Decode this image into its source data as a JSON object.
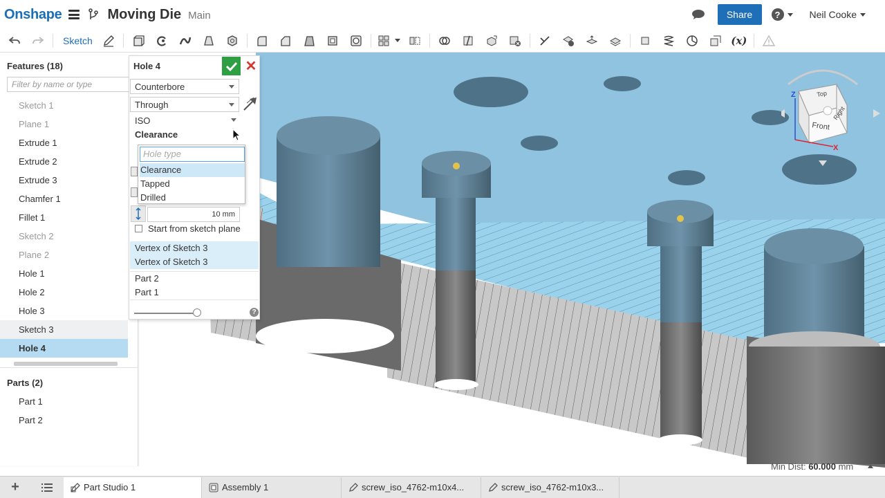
{
  "header": {
    "logo": "Onshape",
    "doc_title": "Moving Die",
    "branch": "Main",
    "share_label": "Share",
    "help_label": "?",
    "user_name": "Neil Cooke"
  },
  "toolbar": {
    "sketch_label": "Sketch",
    "variable_label": "(x)"
  },
  "features": {
    "header": "Features (18)",
    "filter_placeholder": "Filter by name or type",
    "items": [
      {
        "label": "Sketch 1",
        "state": "dim"
      },
      {
        "label": "Plane 1",
        "state": "dim"
      },
      {
        "label": "Extrude 1",
        "state": ""
      },
      {
        "label": "Extrude 2",
        "state": ""
      },
      {
        "label": "Extrude 3",
        "state": ""
      },
      {
        "label": "Chamfer 1",
        "state": ""
      },
      {
        "label": "Fillet 1",
        "state": ""
      },
      {
        "label": "Sketch 2",
        "state": "dim"
      },
      {
        "label": "Plane 2",
        "state": "dim"
      },
      {
        "label": "Hole 1",
        "state": ""
      },
      {
        "label": "Hole 2",
        "state": ""
      },
      {
        "label": "Hole 3",
        "state": ""
      },
      {
        "label": "Sketch 3",
        "state": "hover"
      },
      {
        "label": "Hole 4",
        "state": "sel"
      }
    ]
  },
  "parts": {
    "header": "Parts (2)",
    "items": [
      "Part 1",
      "Part 2"
    ]
  },
  "hole_dialog": {
    "title": "Hole 4",
    "hole_style": "Counterbore",
    "termination": "Through",
    "standard": "ISO",
    "type_label": "Clearance",
    "dropdown": {
      "placeholder": "Hole type",
      "options": [
        "Clearance",
        "Tapped",
        "Drilled"
      ],
      "selected": "Clearance"
    },
    "depth_value": "10 mm",
    "start_from_sketch_plane": "Start from sketch plane",
    "sketch_points": [
      "Vertex of Sketch 3",
      "Vertex of Sketch 3"
    ],
    "scope_parts": [
      "Part 2",
      "Part 1"
    ],
    "help": "?"
  },
  "viewcube": {
    "front": "Front",
    "right": "Right",
    "top": "Top",
    "z_axis": "Z",
    "x_axis": "X"
  },
  "status": {
    "min_dist_label": "Min Dist:",
    "min_dist_value": "60.000",
    "min_dist_unit": "mm"
  },
  "tabs": [
    {
      "label": "Part Studio 1",
      "active": true,
      "kind": "partstudio"
    },
    {
      "label": "Assembly 1",
      "active": false,
      "kind": "assembly"
    },
    {
      "label": "screw_iso_4762-m10x4...",
      "active": false,
      "kind": "part"
    },
    {
      "label": "screw_iso_4762-m10x3...",
      "active": false,
      "kind": "part"
    }
  ],
  "colors": {
    "brand_blue": "#1a6fb6",
    "share_blue": "#1f6fb8",
    "ok_green": "#2ea043",
    "cancel_red": "#d9342b",
    "selection_blue": "#b4dbf2",
    "face_blue": "#8fc3e0"
  }
}
